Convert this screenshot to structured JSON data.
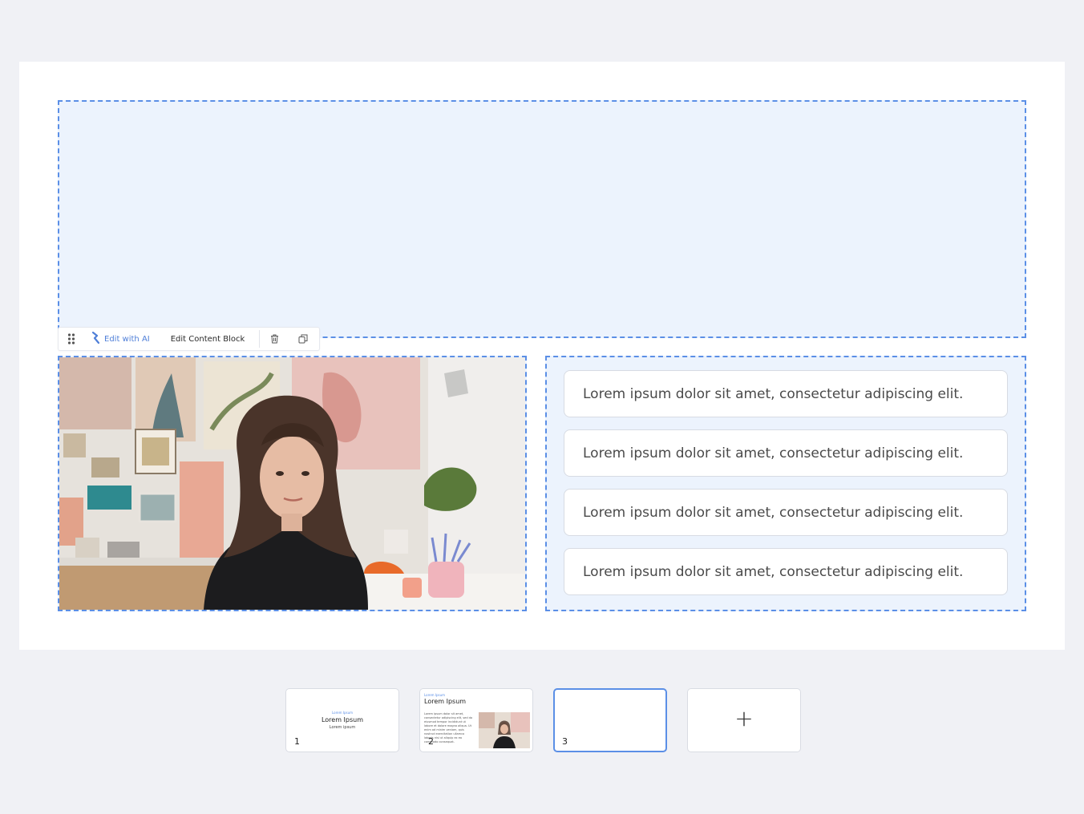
{
  "toolbar": {
    "drag_icon": "drag-handle-icon",
    "ai_icon": "ai-sparkle-icon",
    "edit_ai_label": "Edit with AI",
    "edit_block_label": "Edit Content Block",
    "delete_icon": "trash-icon",
    "duplicate_icon": "duplicate-icon"
  },
  "image_block": {
    "image": "portrait of woman in art studio"
  },
  "list": {
    "items": [
      {
        "text": "Lorem ipsum dolor sit amet, consectetur adipiscing elit."
      },
      {
        "text": "Lorem ipsum dolor sit amet, consectetur adipiscing elit."
      },
      {
        "text": "Lorem ipsum dolor sit amet, consectetur adipiscing elit."
      },
      {
        "text": "Lorem ipsum dolor sit amet, consectetur adipiscing elit."
      }
    ]
  },
  "slides": [
    {
      "num": "1",
      "sub": "Lorem Ipsum",
      "title": "Lorem Ipsum",
      "small": "Lorem ipsum"
    },
    {
      "num": "2",
      "sub": "Lorem Ipsum",
      "title": "Lorem Ipsum",
      "body": "Lorem ipsum dolor sit amet, consectetur adipiscing elit, sed do eiusmod tempor incididunt ut labore et dolore magna aliqua. Ut enim ad minim veniam, quis nostrud exercitation ullamco laboris nisi ut aliquip ex ea commodo consequat."
    },
    {
      "num": "3"
    }
  ],
  "add_slide": {
    "label": "+"
  },
  "colors": {
    "accent": "#5b8fe6",
    "block_fill": "#ecf3fd",
    "background": "#f0f1f5"
  }
}
